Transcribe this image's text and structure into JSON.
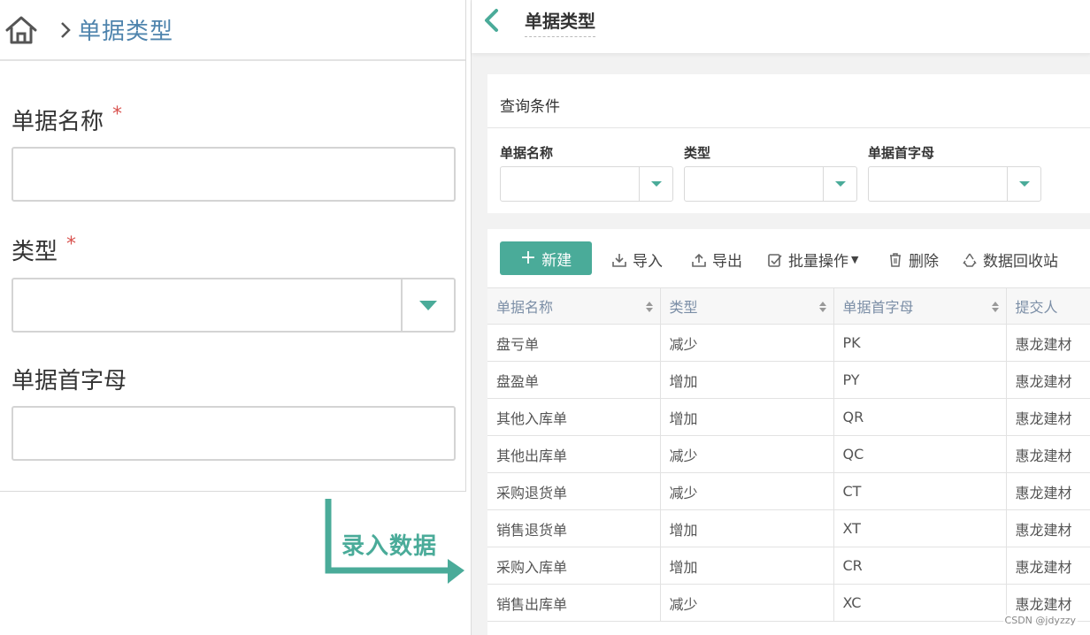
{
  "left_form": {
    "breadcrumb_title": "单据类型",
    "fields": [
      {
        "label": "单据名称",
        "required_mark": "*",
        "value": ""
      },
      {
        "label": "类型",
        "required_mark": "*",
        "value": ""
      },
      {
        "label": "单据首字母",
        "value": ""
      }
    ]
  },
  "arrow": {
    "label": "录入数据",
    "color": "#4aab99"
  },
  "right_panel": {
    "title": "单据类型",
    "query": {
      "title": "查询条件",
      "filters": [
        {
          "label": "单据名称",
          "value": ""
        },
        {
          "label": "类型",
          "value": ""
        },
        {
          "label": "单据首字母",
          "value": ""
        }
      ]
    },
    "toolbar": {
      "new": "新建",
      "import": "导入",
      "export": "导出",
      "batch": "批量操作",
      "delete": "删除",
      "recycle": "数据回收站"
    },
    "table": {
      "columns": [
        "单据名称",
        "类型",
        "单据首字母",
        "提交人"
      ],
      "rows": [
        [
          "盘亏单",
          "减少",
          "PK",
          "惠龙建材"
        ],
        [
          "盘盈单",
          "增加",
          "PY",
          "惠龙建材"
        ],
        [
          "其他入库单",
          "增加",
          "QR",
          "惠龙建材"
        ],
        [
          "其他出库单",
          "减少",
          "QC",
          "惠龙建材"
        ],
        [
          "采购退货单",
          "减少",
          "CT",
          "惠龙建材"
        ],
        [
          "销售退货单",
          "增加",
          "XT",
          "惠龙建材"
        ],
        [
          "采购入库单",
          "增加",
          "CR",
          "惠龙建材"
        ],
        [
          "销售出库单",
          "减少",
          "XC",
          "惠龙建材"
        ]
      ]
    }
  },
  "watermark": "CSDN @jdyzzy",
  "colors": {
    "accent": "#4aab99",
    "breadcrumb": "#4f84ad",
    "required": "#d9534f"
  }
}
